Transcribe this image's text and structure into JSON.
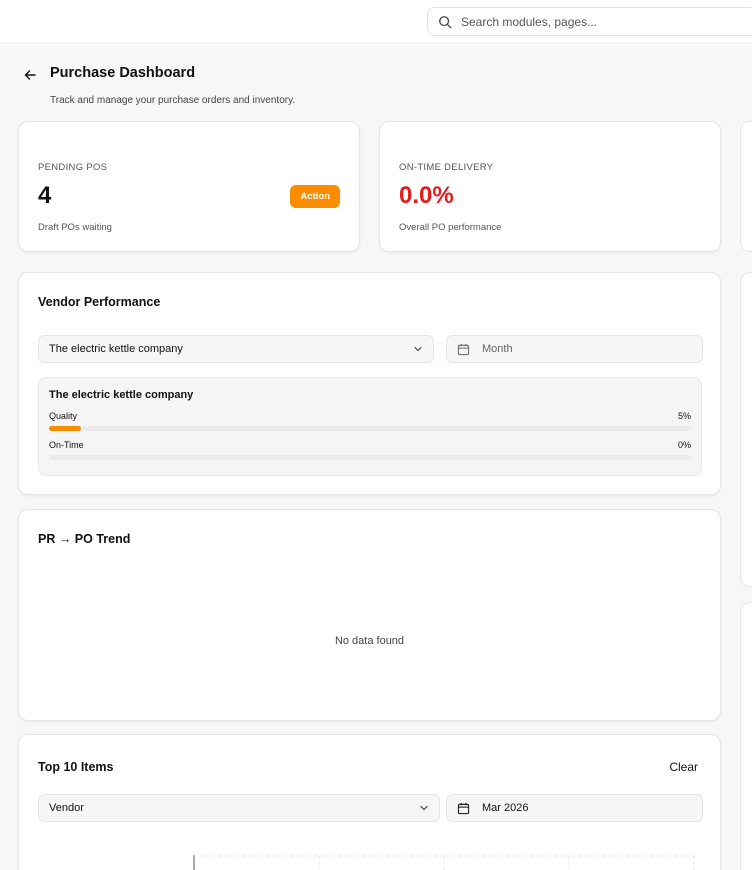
{
  "search": {
    "placeholder": "Search modules, pages..."
  },
  "header": {
    "title": "Purchase Dashboard",
    "subtitle": "Track and manage your purchase orders and inventory."
  },
  "kpis": {
    "pending": {
      "label": "PENDING POS",
      "value": "4",
      "note": "Draft POs waiting",
      "badge": "Action",
      "badge_color": "#fb8c00"
    },
    "ontime": {
      "label": "ON-TIME DELIVERY",
      "value": "0.0%",
      "note": "Overall PO performance",
      "value_color": "#e01e1e"
    }
  },
  "vendor_performance": {
    "title": "Vendor Performance",
    "vendor_select": "The electric kettle company",
    "date_placeholder": "Month",
    "box_title": "The electric kettle company",
    "metrics": [
      {
        "label": "Quality",
        "value_text": "5%",
        "fraction": 0.05,
        "color": "#fb8c00"
      },
      {
        "label": "On-Time",
        "value_text": "0%",
        "fraction": 0.0,
        "color": "#fb8c00"
      }
    ]
  },
  "trend": {
    "title": "PR → PO Trend",
    "empty_text": "No data found"
  },
  "top_items": {
    "title": "Top 10 Items",
    "clear_label": "Clear",
    "vendor_select": "Vendor",
    "date_value": "Mar 2026"
  },
  "colors": {
    "accent": "#fb8c00",
    "danger": "#e01e1e"
  },
  "icons": [
    "search-icon",
    "back-arrow-icon",
    "chevron-down-icon",
    "calendar-icon"
  ]
}
